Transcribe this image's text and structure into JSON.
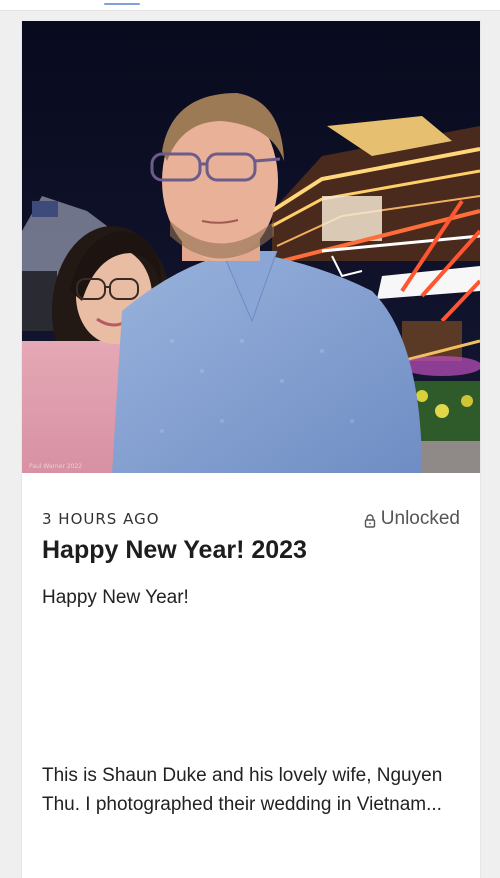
{
  "post": {
    "timestamp": "3 HOURS AGO",
    "lock_status": "Unlocked",
    "lock_icon": "lock-icon",
    "title": "Happy New Year! 2023",
    "subtitle": "Happy New Year!",
    "excerpt": "This is Shaun Duke and his lovely wife, Nguyen Thu.  I photographed their wedding in Vietnam...",
    "photo_watermark": "Paul Warner 2022"
  },
  "colors": {
    "page_background": "#efefef",
    "card_background": "#ffffff",
    "title_text": "#1d1d1d",
    "meta_text": "#555555"
  }
}
